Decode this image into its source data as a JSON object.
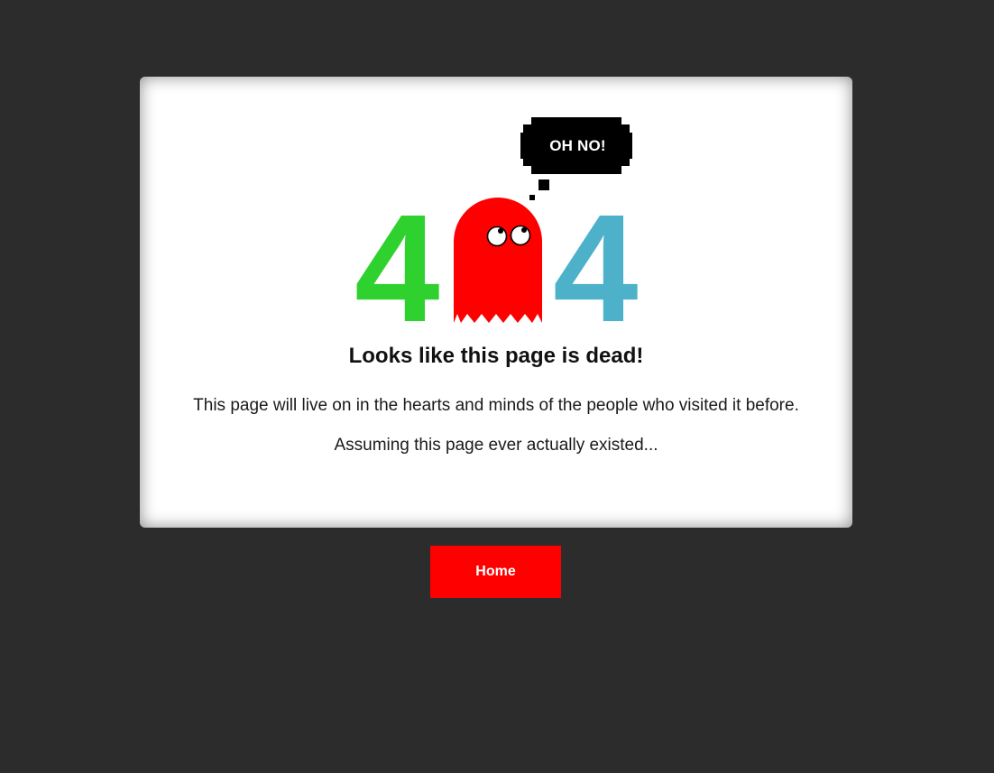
{
  "error": {
    "digit_left": "4",
    "digit_right": "4",
    "bubble_text": "OH NO!",
    "headline": "Looks like this page is dead!",
    "message_1": "This page will live on in the hearts and minds of the people who visited it before.",
    "message_2": "Assuming this page ever actually existed..."
  },
  "nav": {
    "home_label": "Home"
  },
  "colors": {
    "background": "#2c2c2c",
    "card": "#ffffff",
    "digit_left": "#2fd12f",
    "digit_right": "#4cb1c9",
    "ghost": "#ff0000",
    "button": "#ff0000"
  },
  "icons": {
    "ghost": "ghost-icon",
    "bubble": "speech-bubble-icon"
  }
}
